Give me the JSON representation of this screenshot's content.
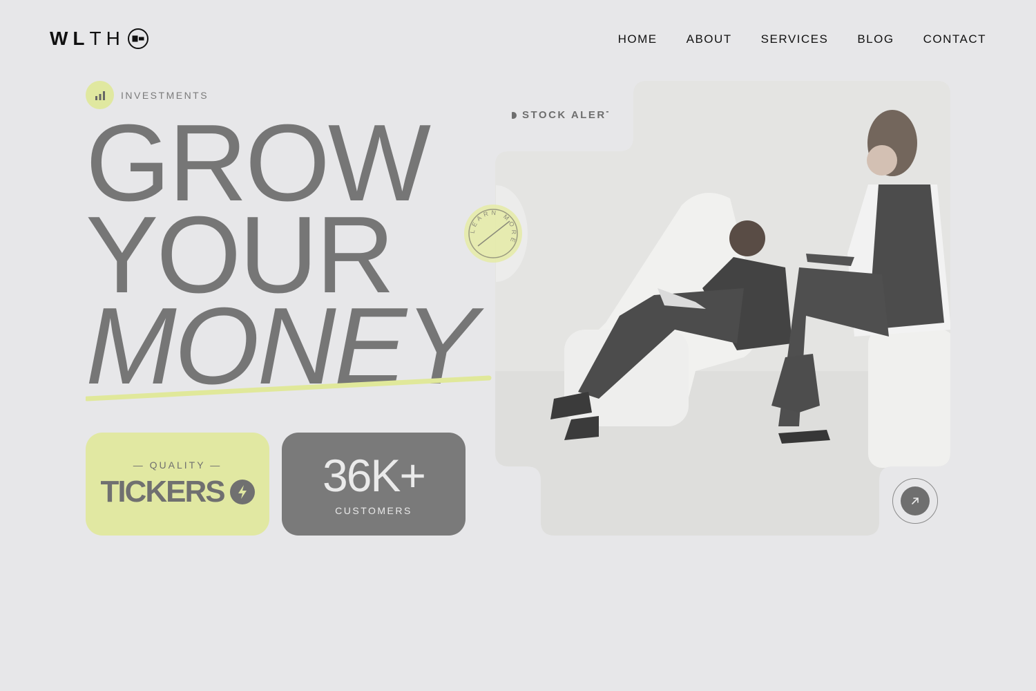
{
  "brand": {
    "name_bold": "WL",
    "name_light": "TH"
  },
  "nav": {
    "items": [
      {
        "label": "HOME"
      },
      {
        "label": "ABOUT"
      },
      {
        "label": "SERVICES"
      },
      {
        "label": "BLOG"
      },
      {
        "label": "CONTACT"
      }
    ]
  },
  "hero": {
    "tag": {
      "label": "INVESTMENTS",
      "icon": "bar-chart-icon"
    },
    "headline": {
      "line1": "GROW",
      "line2": "YOUR",
      "line3": "MONEY"
    },
    "stock_alert": "STOCK ALERTS",
    "badge_text": "LEARN MORE",
    "quality_card": {
      "kicker": "— QUALITY —",
      "title": "TICKERS",
      "icon": "lightning-bolt-icon"
    },
    "customers_card": {
      "value": "36K+",
      "label": "CUSTOMERS"
    }
  },
  "colors": {
    "background": "#e7e7e9",
    "accent_lime": "#e1e8a2",
    "headline_gray": "#767676",
    "dark_card": "#7a7a7a"
  }
}
